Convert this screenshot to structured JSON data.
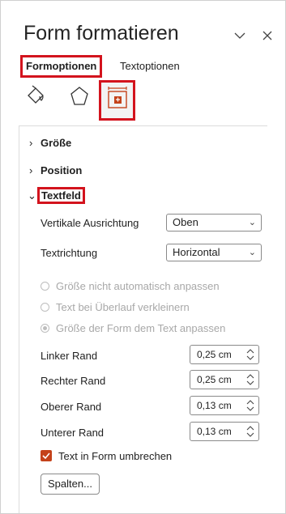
{
  "pane": {
    "title": "Form formatieren",
    "collapse_icon": "chevron-down-icon",
    "close_icon": "close-icon"
  },
  "tabs": {
    "active": "Formoptionen",
    "inactive": "Textoptionen"
  },
  "categories": {
    "fill_icon": "paint-bucket-icon",
    "effects_icon": "pentagon-icon",
    "layout_icon": "size-properties-icon"
  },
  "sections": {
    "size": "Größe",
    "position": "Position",
    "textbox": "Textfeld"
  },
  "textbox": {
    "vertical_alignment_label": "Vertikale Ausrichtung",
    "vertical_alignment_value": "Oben",
    "text_direction_label": "Textrichtung",
    "text_direction_value": "Horizontal",
    "radio_no_autofit": "Größe nicht automatisch anpassen",
    "radio_shrink_text": "Text bei Überlauf verkleinern",
    "radio_resize_shape": "Größe der Form dem Text anpassen",
    "left_margin_label": "Linker Rand",
    "left_margin_value": "0,25 cm",
    "right_margin_label": "Rechter Rand",
    "right_margin_value": "0,25 cm",
    "top_margin_label": "Oberer Rand",
    "top_margin_value": "0,13 cm",
    "bottom_margin_label": "Unterer Rand",
    "bottom_margin_value": "0,13 cm",
    "wrap_text_label": "Text in Form umbrechen",
    "wrap_text_checked": true,
    "columns_button": "Spalten..."
  },
  "colors": {
    "highlight": "#d3131d",
    "accent": "#c4421a"
  }
}
